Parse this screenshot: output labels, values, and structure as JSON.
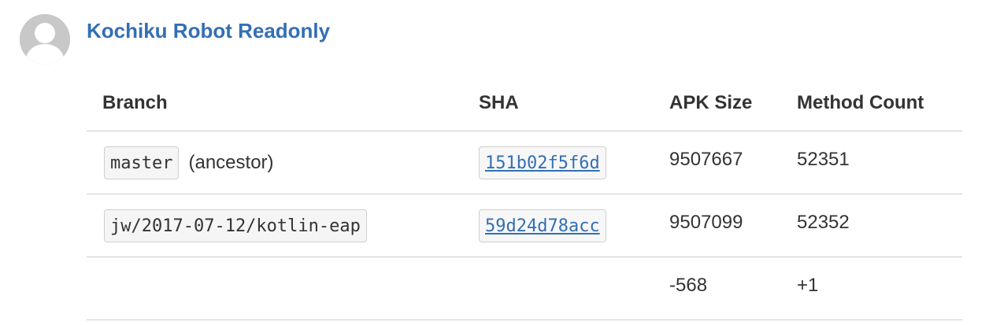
{
  "author": {
    "name": "Kochiku Robot Readonly"
  },
  "table": {
    "headers": {
      "branch": "Branch",
      "sha": "SHA",
      "apk_size": "APK Size",
      "method_count": "Method Count"
    },
    "rows": [
      {
        "branch": "master",
        "note": "(ancestor)",
        "sha": "151b02f5f6d",
        "apk_size": "9507667",
        "method_count": "52351"
      },
      {
        "branch": "jw/2017-07-12/kotlin-eap",
        "note": "",
        "sha": "59d24d78acc",
        "apk_size": "9507099",
        "method_count": "52352"
      }
    ],
    "diff": {
      "apk_size": "-568",
      "method_count": "+1"
    }
  },
  "colors": {
    "link": "#336fb3",
    "avatar": "#c8c8c8",
    "border": "#cfcfcf"
  },
  "icons": {
    "avatar": "default-user-avatar-icon"
  }
}
